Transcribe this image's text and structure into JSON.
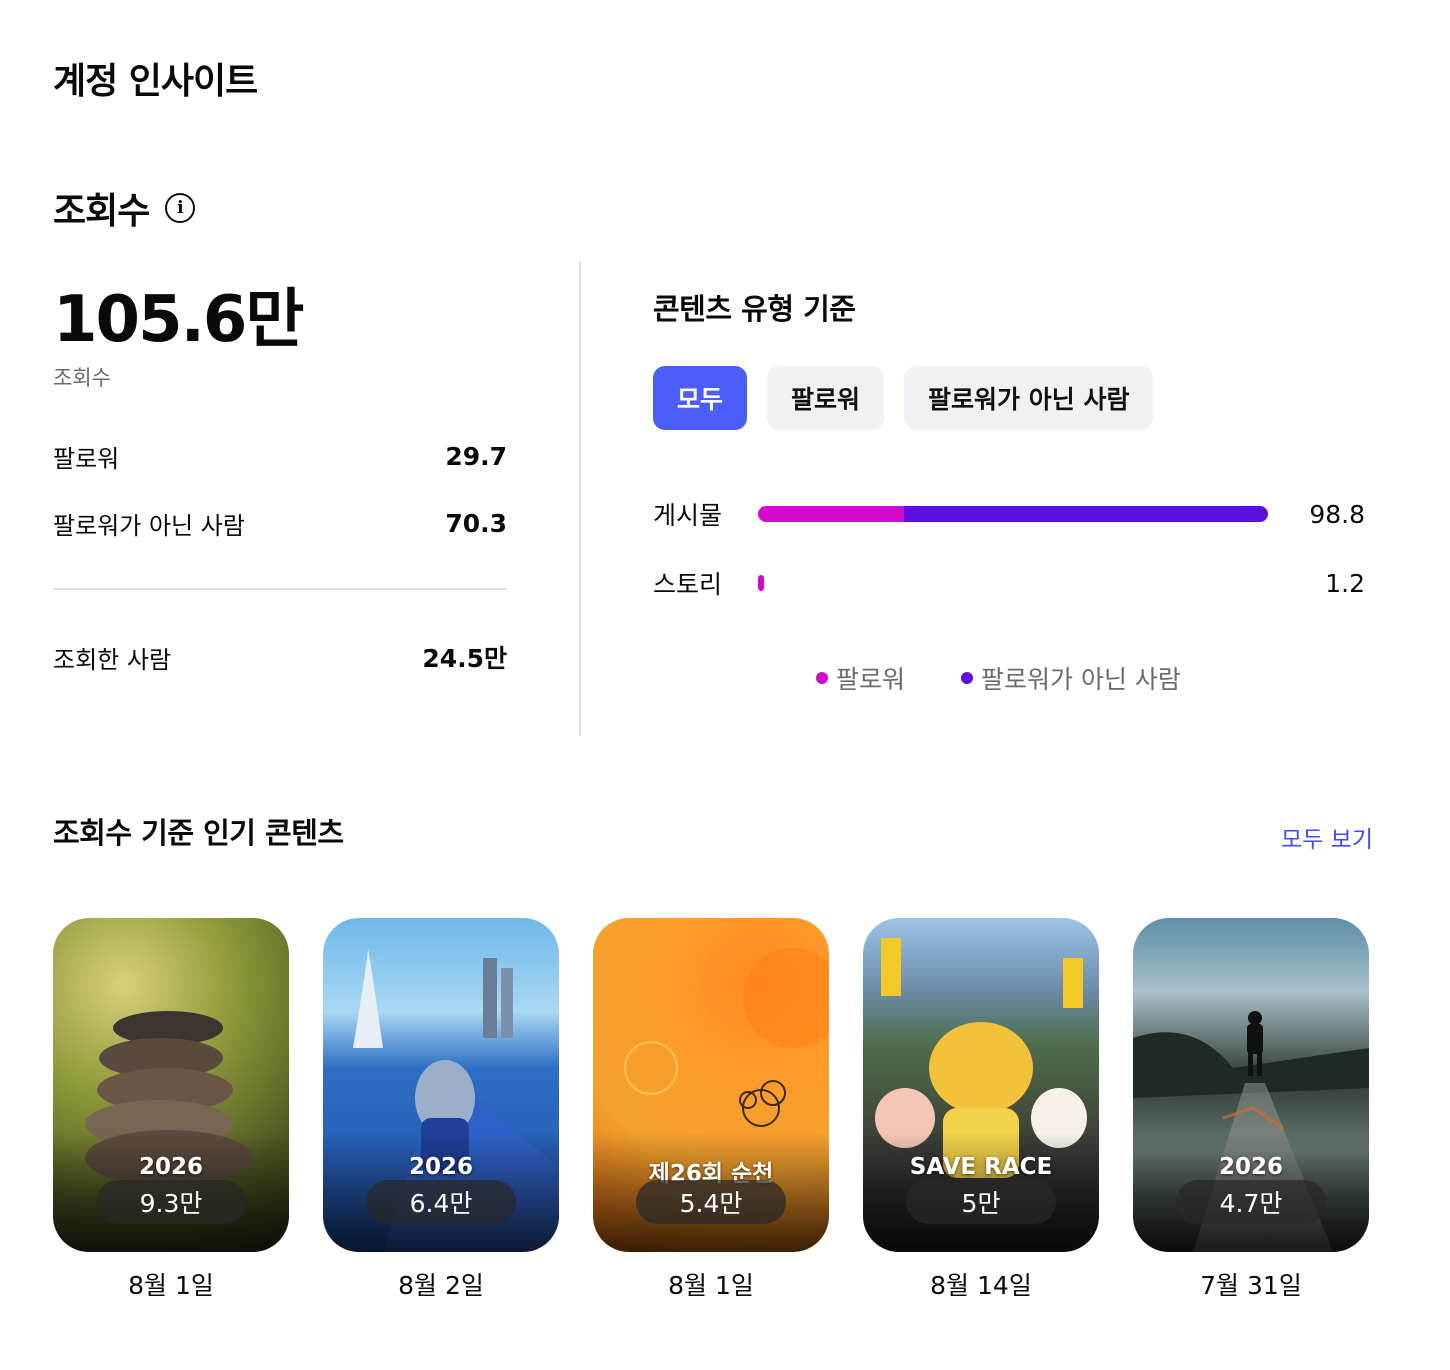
{
  "page": {
    "title": "계정 인사이트"
  },
  "views_section": {
    "title": "조회수",
    "info_icon": "info-icon",
    "total": "105.6만",
    "total_label": "조회수",
    "followers_label": "팔로워",
    "followers_value": "29.7",
    "non_followers_label": "팔로워가 아닌 사람",
    "non_followers_value": "70.3",
    "viewers_label": "조회한 사람",
    "viewers_value": "24.5만"
  },
  "content_type": {
    "title": "콘텐츠 유형 기준",
    "chips": [
      "모두",
      "팔로워",
      "팔로워가 아닌 사람"
    ],
    "active_chip": "모두",
    "bars": [
      {
        "label": "게시물",
        "value": "98.8",
        "followers_share": 28.6,
        "non_followers_share": 71.4
      },
      {
        "label": "스토리",
        "value": "1.2",
        "followers_share": 100,
        "non_followers_share": 0
      }
    ],
    "legend": [
      {
        "label": "팔로워",
        "color": "#d10ccf"
      },
      {
        "label": "팔로워가 아닌 사람",
        "color": "#5b10e0"
      }
    ]
  },
  "popular": {
    "title": "조회수 기준 인기 콘텐츠",
    "see_all": "모두 보기",
    "items": [
      {
        "caption": "2026",
        "views": "9.3만",
        "date": "8월 1일"
      },
      {
        "caption": "2026",
        "views": "6.4만",
        "date": "8월 2일"
      },
      {
        "caption": "제26회 순천",
        "views": "5.4만",
        "date": "8월 1일"
      },
      {
        "caption": "SAVE RACE",
        "views": "5만",
        "date": "8월 14일"
      },
      {
        "caption": "2026",
        "views": "4.7만",
        "date": "7월 31일"
      }
    ]
  }
}
